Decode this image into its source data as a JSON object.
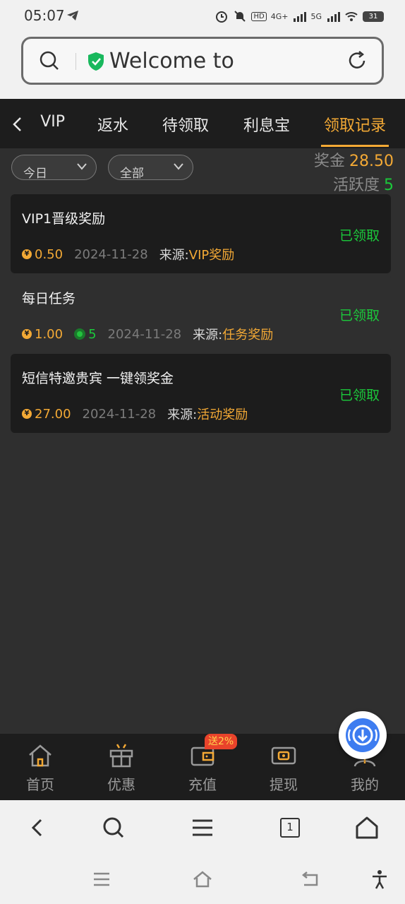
{
  "status_bar": {
    "time": "05:07",
    "network_1": "4G+",
    "network_2": "5G",
    "hd_label": "HD",
    "battery": "31"
  },
  "address_bar": {
    "text": "Welcome to"
  },
  "tabs": [
    {
      "label": "VIP"
    },
    {
      "label": "返水"
    },
    {
      "label": "待领取"
    },
    {
      "label": "利息宝"
    },
    {
      "label": "领取记录",
      "active": true
    }
  ],
  "filters": {
    "date_selected": "今日",
    "type_selected": "全部"
  },
  "summary": {
    "bonus_label": "奖金",
    "bonus_value": "28.50",
    "activity_label": "活跃度",
    "activity_value": "5"
  },
  "records": [
    {
      "title": "VIP1晋级奖励",
      "amount": "0.50",
      "points": "",
      "date": "2024-11-28",
      "source_label": "来源:",
      "source_value": "VIP奖励",
      "status": "已领取"
    },
    {
      "title": "每日任务",
      "amount": "1.00",
      "points": "5",
      "date": "2024-11-28",
      "source_label": "来源:",
      "source_value": "任务奖励",
      "status": "已领取"
    },
    {
      "title": "短信特邀贵宾 一键领奖金",
      "amount": "27.00",
      "points": "",
      "date": "2024-11-28",
      "source_label": "来源:",
      "source_value": "活动奖励",
      "status": "已领取"
    }
  ],
  "bottom_nav": [
    {
      "label": "首页",
      "icon": "home-icon"
    },
    {
      "label": "优惠",
      "icon": "gift-icon"
    },
    {
      "label": "充值",
      "icon": "wallet-icon"
    },
    {
      "label": "提现",
      "icon": "withdraw-icon"
    },
    {
      "label": "我的",
      "icon": "profile-icon"
    }
  ],
  "promo_badge": "送2%",
  "browser": {
    "tab_count": "1"
  },
  "colors": {
    "accent": "#f3a935",
    "success": "#1bc93b",
    "dark_bg": "#1d1d1d"
  }
}
